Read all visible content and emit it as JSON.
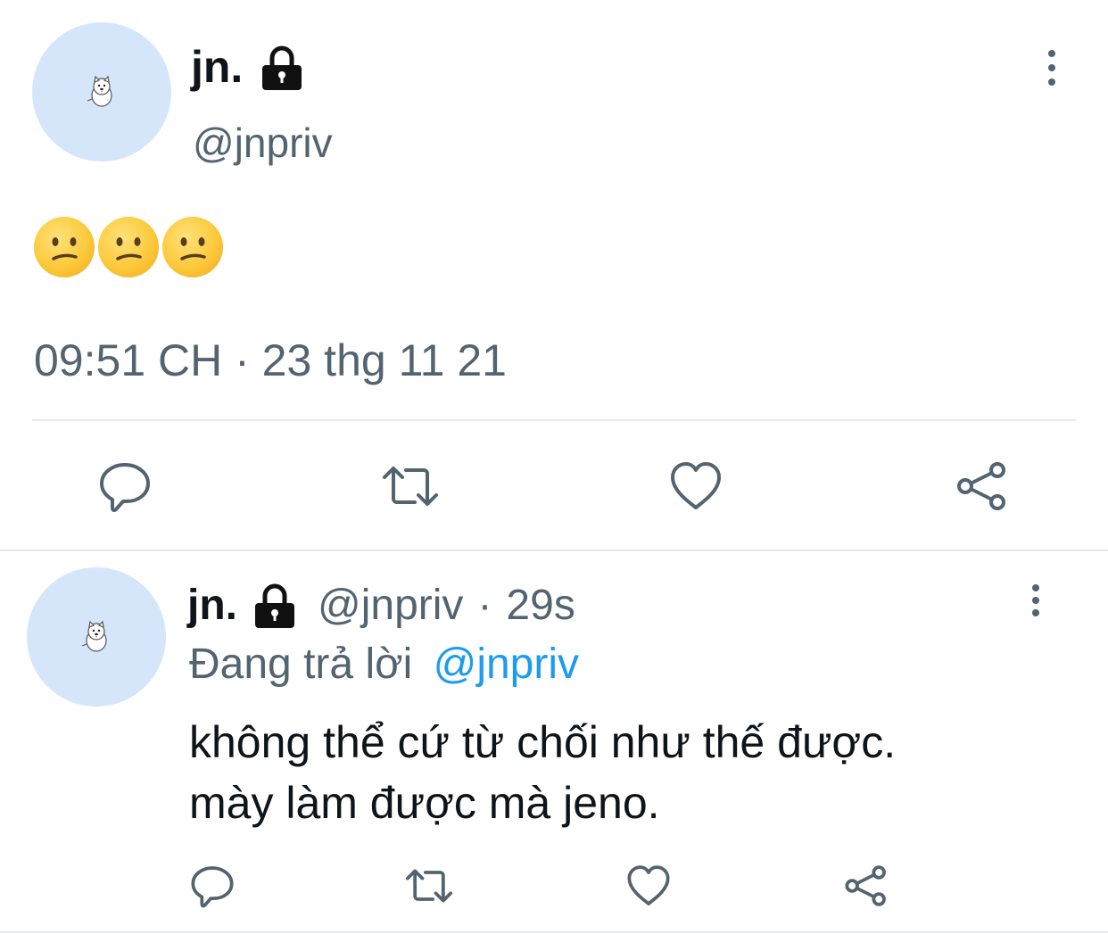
{
  "main_tweet": {
    "display_name": "jn.",
    "handle": "@jnpriv",
    "content": "😕😕😕",
    "emoji_count": 3,
    "emoji_name": "confused-face",
    "timestamp": "09:51 CH · 23 thg 11 21",
    "icons": {
      "avatar": "dog-avatar-icon",
      "locked": "lock-icon",
      "more": "more-vertical-icon",
      "reply": "reply-icon",
      "retweet": "retweet-icon",
      "like": "heart-icon",
      "share": "share-icon"
    }
  },
  "reply_tweet": {
    "display_name": "jn.",
    "handle": "@jnpriv",
    "time_ago": "29s",
    "separator": "·",
    "replying_label": "Đang trả lời",
    "replying_to": "@jnpriv",
    "text_line1": "không thể cứ từ chối như thế được.",
    "text_line2": "mày làm được mà jeno."
  },
  "colors": {
    "text_primary": "#0f1419",
    "text_secondary": "#536471",
    "link": "#1d9bf0",
    "avatar_bg": "#d5e6fb",
    "divider": "#e7e9eb"
  }
}
